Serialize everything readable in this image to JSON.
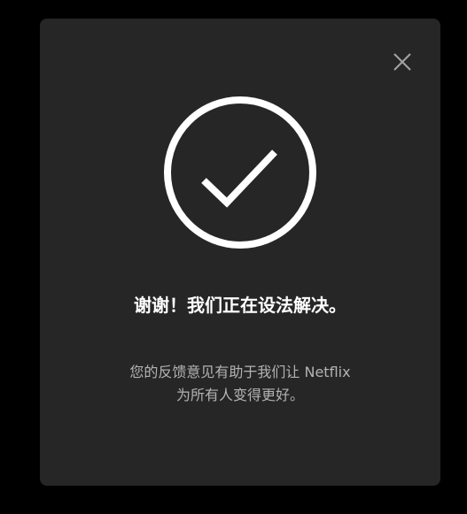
{
  "dialog": {
    "title": "谢谢！我们正在设法解决。",
    "message": "您的反馈意见有助于我们让 Netflix 为所有人变得更好。",
    "close_icon": "close-icon",
    "status_icon": "check-circle-icon"
  },
  "colors": {
    "page_background": "#000000",
    "modal_background": "#262626",
    "title_text": "#ffffff",
    "message_text": "#b3b3b3",
    "icon_stroke": "#ffffff",
    "close_icon": "#a3a3a3"
  }
}
